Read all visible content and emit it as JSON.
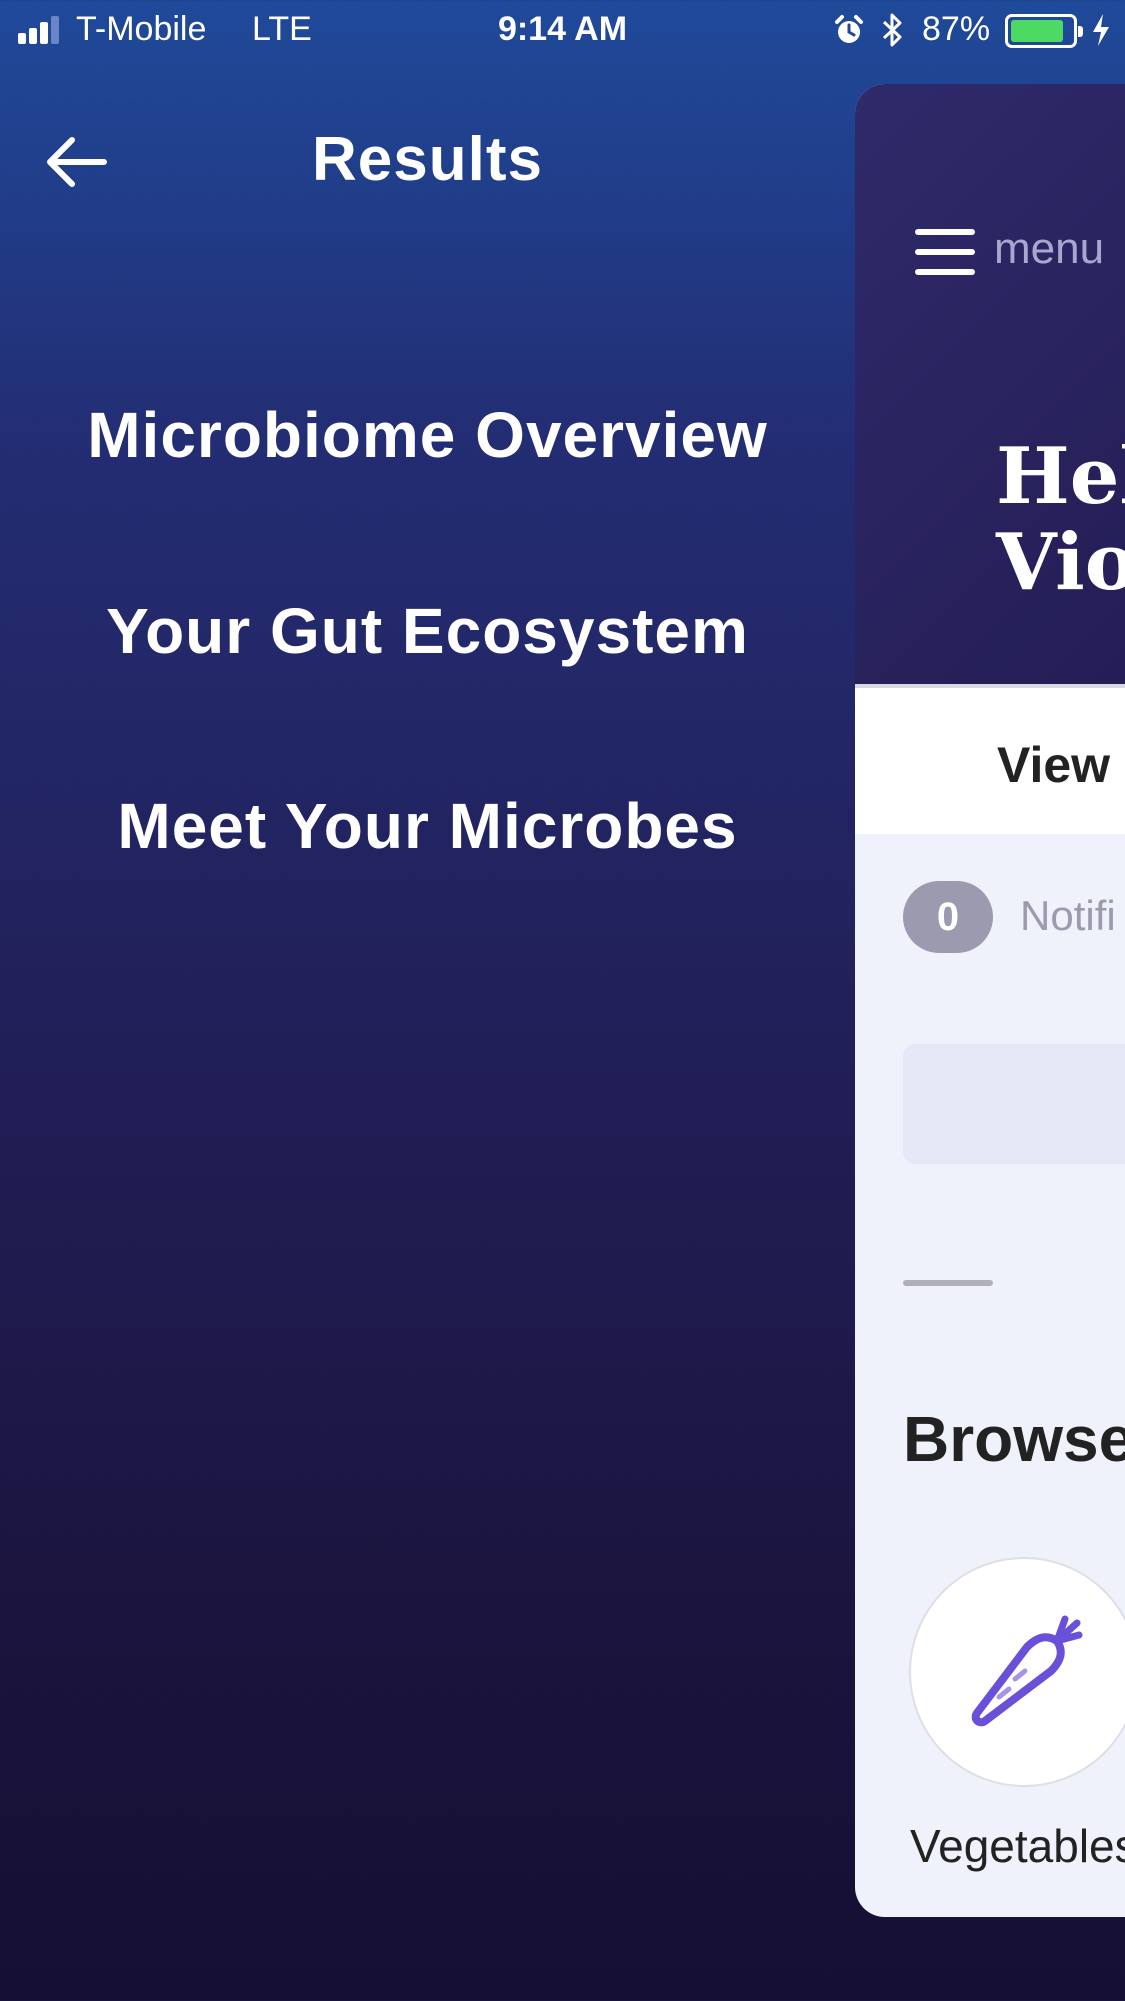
{
  "status_bar": {
    "carrier": "T-Mobile",
    "network": "LTE",
    "time": "9:14 AM",
    "battery": "87%",
    "battery_level": 0.87,
    "icons": [
      "signal-icon",
      "alarm-icon",
      "bluetooth-icon",
      "battery-icon",
      "charging-icon"
    ]
  },
  "header": {
    "title": "Results",
    "back_icon": "arrow-left-icon"
  },
  "menu": {
    "items": [
      {
        "label": "Microbiome Overview"
      },
      {
        "label": "Your Gut Ecosystem"
      },
      {
        "label": "Meet Your Microbes"
      }
    ]
  },
  "main_panel": {
    "menu_label": "menu",
    "greeting_line1": "Hell",
    "greeting_line2": "Viol",
    "view_tab_label": "View",
    "notification_count": "0",
    "notification_label": "Notifi",
    "browse_heading": "Browse",
    "category_label": "Vegetables",
    "category_icon": "carrot-icon"
  },
  "colors": {
    "gradient_top": "#1f4a9a",
    "gradient_bottom": "#150f33",
    "accent_purple": "#6a4fd8",
    "battery_green": "#4cd964"
  }
}
